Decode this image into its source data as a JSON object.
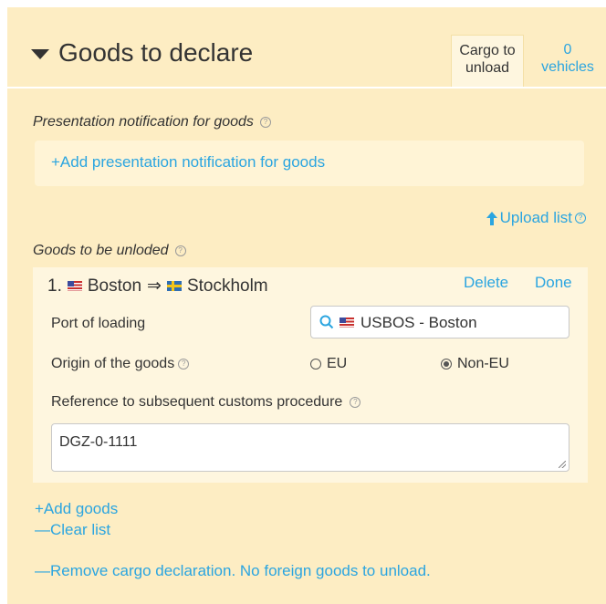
{
  "header": {
    "title": "Goods to declare",
    "tabs": [
      {
        "line1": "Cargo to",
        "line2": "unload"
      },
      {
        "line1": "0",
        "line2": "vehicles"
      }
    ]
  },
  "presentation": {
    "label": "Presentation notification for goods",
    "add_link": "+Add presentation notification for goods"
  },
  "upload": {
    "label": "Upload list"
  },
  "goods": {
    "label": "Goods to be unloded",
    "item": {
      "number": "1.",
      "from": "Boston",
      "arrow": "⇒",
      "to": "Stockholm",
      "delete_label": "Delete",
      "done_label": "Done",
      "port_label": "Port of loading",
      "port_value": "USBOS - Boston",
      "origin_label": "Origin of the goods",
      "origin_options": [
        "EU",
        "Non-EU"
      ],
      "origin_selected": "Non-EU",
      "reference_label": "Reference to subsequent customs procedure",
      "reference_value": "DGZ-0-1111"
    }
  },
  "actions": {
    "add_goods": "+Add goods",
    "clear_list": "—Clear list",
    "remove_declaration": "—Remove cargo declaration. No foreign goods to unload."
  },
  "colors": {
    "accent": "#2ba5e0",
    "panel": "#fdedc3",
    "box": "#fef6df"
  }
}
